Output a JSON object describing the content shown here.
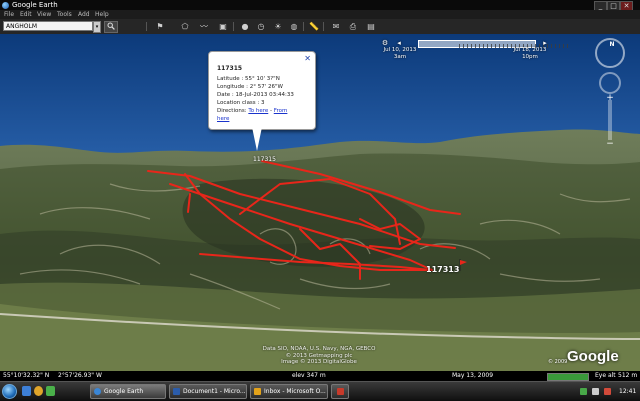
{
  "window": {
    "title": "Google Earth",
    "controls": [
      "_",
      "□",
      "✕"
    ]
  },
  "menu": [
    "File",
    "Edit",
    "View",
    "Tools",
    "Add",
    "Help"
  ],
  "search": {
    "value": "ANGHOLM"
  },
  "time_slider": {
    "start_label": "Jul 10, 2013",
    "start_time": "3am",
    "end_label": "Jul 18, 2013",
    "end_time": "10pm"
  },
  "navigation": {
    "compass_label": "N"
  },
  "balloon": {
    "title": "117315",
    "latitude": "Latitude : 55° 10' 3?\"N",
    "longitude": "Longitude : 2° 57' 26\"W",
    "date": "Date : 18-Jul-2013 03:44:33",
    "location_class": "Location class : 3",
    "directions_prefix": "Directions:",
    "to_here": "To here",
    "separator": " - ",
    "from_here_1": "From",
    "from_here_2": "here",
    "close_icon": "close-icon"
  },
  "map": {
    "track_color": "#e8261a",
    "placemarks": [
      {
        "label": "117315",
        "kind": "track-point"
      },
      {
        "label": "117313",
        "kind": "flag"
      }
    ]
  },
  "attribution": {
    "line1": "Data SIO, NOAA, U.S. Navy, NGA, GEBCO",
    "line2": "© 2013 Getmapping plc",
    "line3": "Image © 2013 DigitalGlobe"
  },
  "logo": {
    "brand": "Google",
    "small": "© 2009"
  },
  "status": {
    "lat": "55°10'32.32\" N",
    "lon": "2°57'26.93\" W",
    "elev": "elev   347 m",
    "date": "May 13, 2009",
    "stream_pct": 100,
    "eye_alt": "Eye alt",
    "eye_value": "512 m"
  },
  "taskbar": {
    "tasks": [
      {
        "label": "Google Earth",
        "icon_color": "#3a86d6",
        "active": true
      },
      {
        "label": "Document1 - Micro...",
        "icon_color": "#2b5caa",
        "active": false
      },
      {
        "label": "Inbox - Microsoft O...",
        "icon_color": "#e3a21a",
        "active": false
      },
      {
        "label": "",
        "icon_color": "#c83a2a",
        "active": false
      }
    ],
    "clock": "12:41"
  }
}
